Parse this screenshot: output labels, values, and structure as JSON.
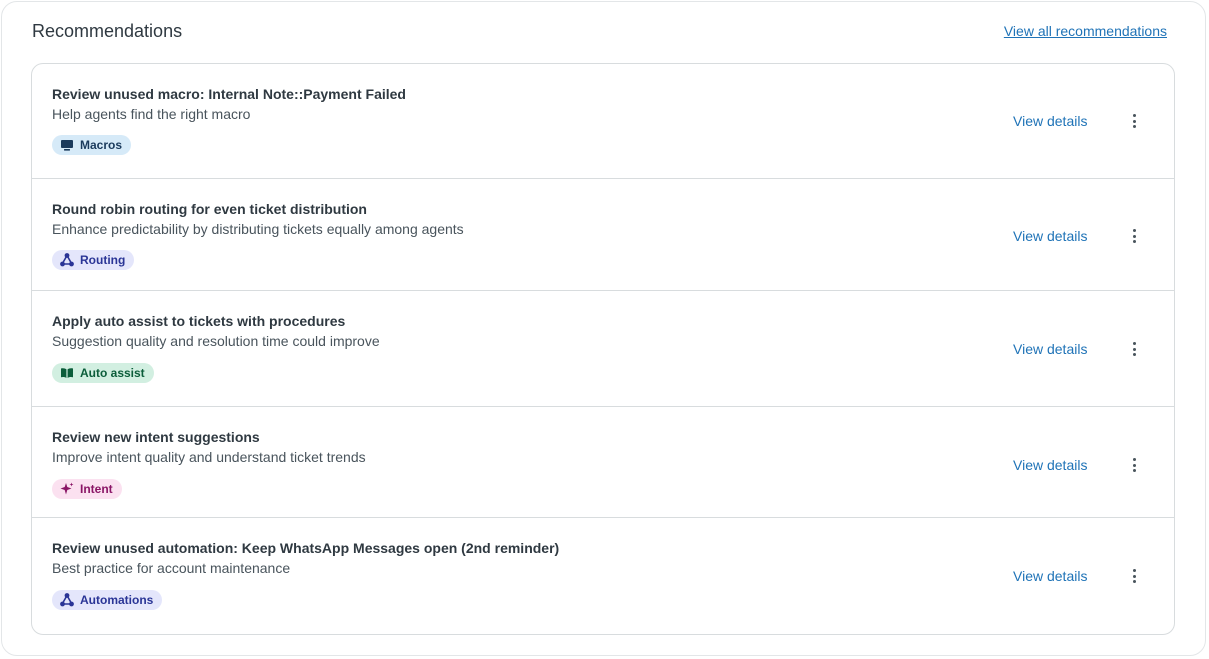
{
  "header": {
    "title": "Recommendations",
    "view_all_label": "View all recommendations"
  },
  "items": [
    {
      "title": "Review unused macro: Internal Note::Payment Failed",
      "subtitle": "Help agents find the right macro",
      "tag": {
        "label": "Macros",
        "icon": "monitor-icon",
        "color": "#d6eaf8"
      },
      "action_label": "View details"
    },
    {
      "title": "Round robin routing for even ticket distribution",
      "subtitle": "Enhance predictability by distributing tickets equally among agents",
      "tag": {
        "label": "Routing",
        "icon": "routing-icon",
        "color": "#e4e6fb"
      },
      "action_label": "View details"
    },
    {
      "title": "Apply auto assist to tickets with procedures",
      "subtitle": "Suggestion quality and resolution time could improve",
      "tag": {
        "label": "Auto assist",
        "icon": "book-icon",
        "color": "#d2efe1"
      },
      "action_label": "View details"
    },
    {
      "title": "Review new intent suggestions",
      "subtitle": "Improve intent quality and understand ticket trends",
      "tag": {
        "label": "Intent",
        "icon": "sparkle-icon",
        "color": "#fbe1f0"
      },
      "action_label": "View details"
    },
    {
      "title": "Review unused automation: Keep WhatsApp Messages open (2nd reminder)",
      "subtitle": "Best practice for account maintenance",
      "tag": {
        "label": "Automations",
        "icon": "routing-icon",
        "color": "#e4e6fb"
      },
      "action_label": "View details"
    }
  ],
  "colors": {
    "link": "#1f73b7",
    "text_primary": "#2f3941",
    "text_secondary": "#49545c",
    "border": "#d8dcde"
  }
}
